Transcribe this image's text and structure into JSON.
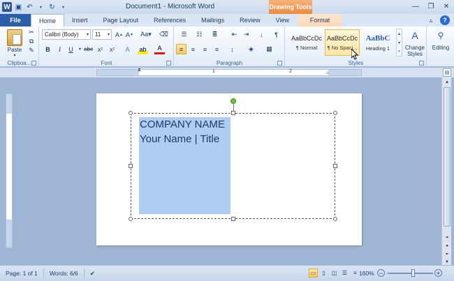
{
  "window": {
    "title": "Document1 - Microsoft Word",
    "contextual_tab": "Drawing Tools"
  },
  "tabs": [
    {
      "label": "File"
    },
    {
      "label": "Home"
    },
    {
      "label": "Insert"
    },
    {
      "label": "Page Layout"
    },
    {
      "label": "References"
    },
    {
      "label": "Mailings"
    },
    {
      "label": "Review"
    },
    {
      "label": "View"
    },
    {
      "label": "Format"
    }
  ],
  "ribbon": {
    "clipboard": {
      "paste_label": "Paste",
      "group_label": "Clipboa..."
    },
    "font": {
      "font_name": "Calibri (Body)",
      "font_size": "11",
      "group_label": "Font"
    },
    "paragraph": {
      "group_label": "Paragraph"
    },
    "styles": {
      "group_label": "Styles",
      "items": [
        {
          "preview": "AaBbCcDc",
          "name": "¶ Normal"
        },
        {
          "preview": "AaBbCcDc",
          "name": "¶ No Spaci..."
        },
        {
          "preview": "AaBbC",
          "name": "Heading 1"
        }
      ],
      "change_styles_label": "Change Styles"
    },
    "editing_label": "Editing"
  },
  "ruler": {
    "numbers": [
      "1",
      "2"
    ]
  },
  "document": {
    "line1": "COMPANY NAME",
    "line2": "Your Name | Title"
  },
  "status": {
    "page": "Page: 1 of 1",
    "words": "Words: 6/6",
    "zoom": "160%"
  }
}
